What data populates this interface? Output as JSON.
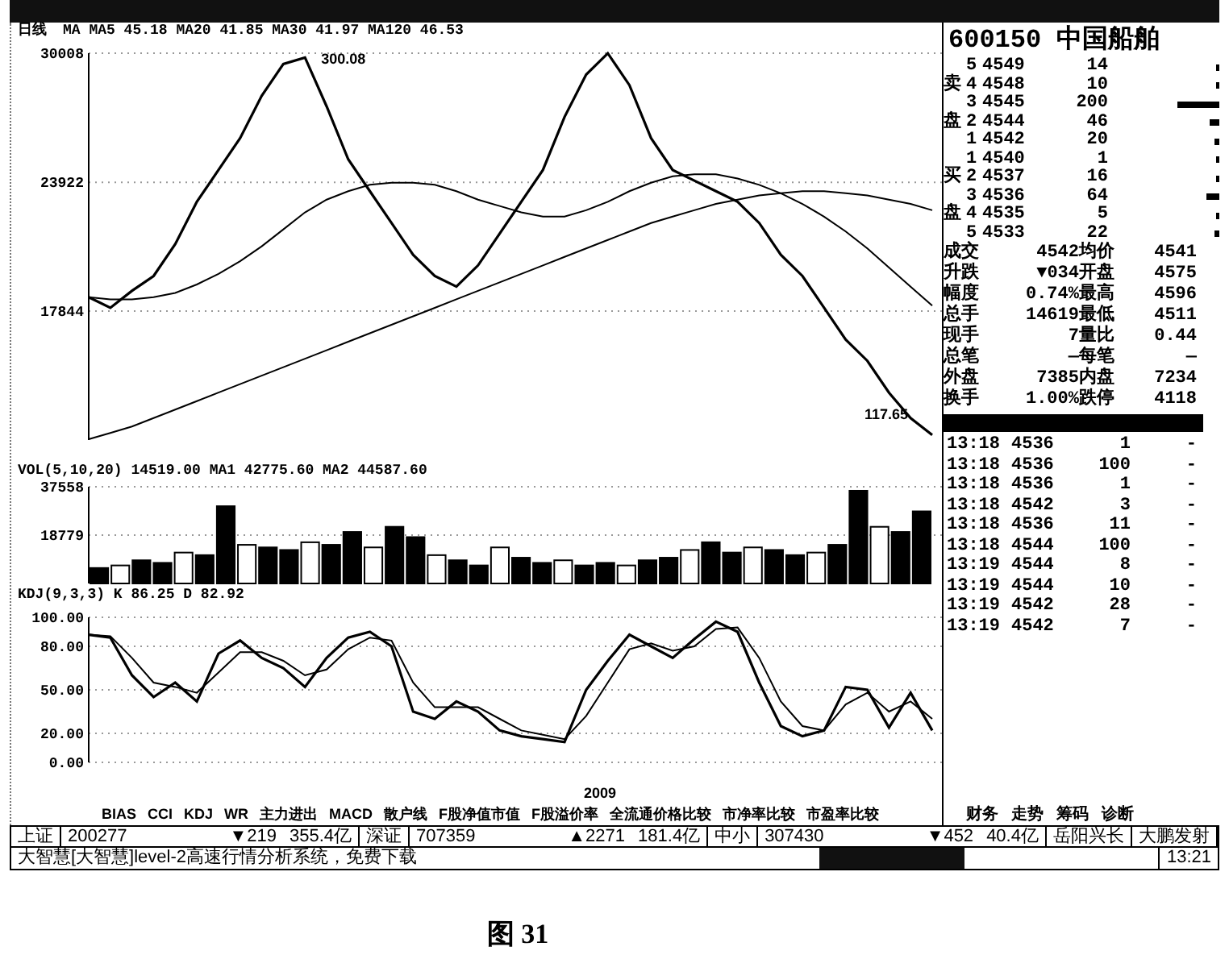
{
  "price_panel": {
    "period": "日线",
    "legend": "MA MA5 45.18 MA20 41.85 MA30 41.97 MA120 46.53",
    "chart_data": {
      "type": "line",
      "grid": true,
      "ylim": [
        11765,
        30008
      ],
      "yticks": [
        17844,
        23922,
        30008
      ],
      "series": [
        {
          "color": "#000000",
          "values": [
            18500,
            18000,
            18800,
            19500,
            21000,
            23000,
            24500,
            26000,
            28000,
            29500,
            29800,
            27500,
            25000,
            23500,
            22000,
            20500,
            19500,
            19000,
            20000,
            21500,
            23000,
            24500,
            27000,
            29000,
            30000,
            28500,
            26000,
            24500,
            24000,
            23500,
            23000,
            22000,
            20500,
            19500,
            18000,
            16500,
            15500,
            14000,
            12800,
            12000
          ]
        },
        {
          "color": "#000000",
          "values": [
            18500,
            18400,
            18400,
            18500,
            18700,
            19100,
            19600,
            20200,
            20900,
            21700,
            22500,
            23100,
            23500,
            23800,
            23900,
            23900,
            23800,
            23500,
            23100,
            22800,
            22500,
            22300,
            22300,
            22600,
            23000,
            23500,
            23900,
            24200,
            24300,
            24300,
            24100,
            23800,
            23400,
            22900,
            22300,
            21600,
            20800,
            19900,
            19000,
            18100
          ]
        },
        {
          "color": "#000000",
          "values": [
            11800,
            12100,
            12400,
            12800,
            13200,
            13600,
            14000,
            14400,
            14800,
            15200,
            15600,
            16000,
            16400,
            16800,
            17200,
            17600,
            18000,
            18400,
            18800,
            19200,
            19600,
            20000,
            20400,
            20800,
            21200,
            21600,
            22000,
            22300,
            22600,
            22900,
            23100,
            23300,
            23400,
            23500,
            23500,
            23400,
            23300,
            23100,
            22900,
            22600
          ]
        }
      ],
      "annotations": [
        "300.08",
        "117.65"
      ]
    }
  },
  "volume_panel": {
    "legend": "VOL(5,10,20) 14519.00 MA1 42775.60 MA2 44587.60",
    "chart_data": {
      "type": "bar",
      "grid": true,
      "ylim": [
        0,
        37558
      ],
      "yticks": [
        18779,
        37558
      ],
      "values": [
        6000,
        7000,
        9000,
        8000,
        12000,
        11000,
        30000,
        15000,
        14000,
        13000,
        16000,
        15000,
        20000,
        14000,
        22000,
        18000,
        11000,
        9000,
        7000,
        14000,
        10000,
        8000,
        9000,
        7000,
        8000,
        7000,
        9000,
        10000,
        13000,
        16000,
        12000,
        14000,
        13000,
        11000,
        12000,
        15000,
        36000,
        22000,
        20000,
        28000
      ]
    }
  },
  "kdj_panel": {
    "legend": "KDJ(9,3,3) K 86.25 D 82.92",
    "year_label": "2009",
    "chart_data": {
      "type": "line",
      "grid": true,
      "ylim": [
        0,
        100
      ],
      "yticks": [
        {
          "value": 0,
          "label": "0.00"
        },
        {
          "value": 20,
          "label": "20.00"
        },
        {
          "value": 50,
          "label": "50.00"
        },
        {
          "value": 80,
          "label": "80.00"
        },
        {
          "value": 100,
          "label": "100.00"
        }
      ],
      "series": [
        {
          "color": "#000000",
          "values": [
            88,
            86,
            60,
            45,
            55,
            42,
            75,
            84,
            72,
            65,
            52,
            72,
            86,
            90,
            80,
            35,
            30,
            42,
            35,
            22,
            18,
            16,
            14,
            50,
            70,
            88,
            80,
            72,
            85,
            97,
            90,
            55,
            25,
            18,
            22,
            52,
            50,
            24,
            48,
            22
          ]
        },
        {
          "color": "#000000",
          "values": [
            88,
            87,
            72,
            55,
            52,
            48,
            62,
            76,
            76,
            70,
            60,
            64,
            78,
            86,
            84,
            55,
            38,
            38,
            38,
            30,
            22,
            19,
            16,
            32,
            55,
            78,
            82,
            77,
            80,
            92,
            93,
            72,
            42,
            25,
            22,
            40,
            48,
            35,
            42,
            30
          ]
        }
      ]
    }
  },
  "indicator_tabs": [
    {
      "label": "BIAS",
      "selected": false
    },
    {
      "label": "CCI",
      "selected": false
    },
    {
      "label": "KDJ",
      "selected": false
    },
    {
      "label": "WR",
      "selected": false
    },
    {
      "label": "主力进出",
      "selected": false
    },
    {
      "label": "MACD",
      "selected": false
    },
    {
      "label": "散户线",
      "selected": false
    },
    {
      "label": "F股净值市值",
      "selected": false
    },
    {
      "label": "F股溢价率",
      "selected": false
    },
    {
      "label": "全流通价格比较",
      "selected": false
    },
    {
      "label": "市净率比较",
      "selected": false
    },
    {
      "label": "市盈率比较",
      "selected": false
    }
  ],
  "side_tabs": [
    {
      "label": "财务",
      "selected": false
    },
    {
      "label": "走势",
      "selected": false
    },
    {
      "label": "筹码",
      "selected": false
    },
    {
      "label": "诊断",
      "selected": false
    }
  ],
  "quote": {
    "title": "600150 中国船舶",
    "sell": [
      {
        "level_no": "5",
        "price": "4549",
        "volume": "14"
      },
      {
        "side_label": "卖",
        "level_no": "4",
        "price": "4548",
        "volume": "10"
      },
      {
        "level_no": "3",
        "price": "4545",
        "volume": "200"
      },
      {
        "side_label": "盘",
        "level_no": "2",
        "price": "4544",
        "volume": "46"
      },
      {
        "level_no": "1",
        "price": "4542",
        "volume": "20"
      }
    ],
    "buy": [
      {
        "level_no": "1",
        "price": "4540",
        "volume": "1"
      },
      {
        "side_label": "买",
        "level_no": "2",
        "price": "4537",
        "volume": "16"
      },
      {
        "level_no": "3",
        "price": "4536",
        "volume": "64"
      },
      {
        "side_label": "盘",
        "level_no": "4",
        "price": "4535",
        "volume": "5"
      },
      {
        "level_no": "5",
        "price": "4533",
        "volume": "22"
      }
    ],
    "stats": [
      {
        "label": "成交",
        "value": "4542",
        "label2": "均价",
        "value2": "4541"
      },
      {
        "label": "升跌",
        "value": "▼034",
        "label2": "开盘",
        "value2": "4575"
      },
      {
        "label": "幅度",
        "value": "0.74%",
        "label2": "最高",
        "value2": "4596"
      },
      {
        "label": "总手",
        "value": "14619",
        "label2": "最低",
        "value2": "4511"
      },
      {
        "label": "现手",
        "value": "7",
        "label2": "量比",
        "value2": "0.44"
      },
      {
        "label": "总笔",
        "value": "—",
        "label2": "每笔",
        "value2": "—"
      },
      {
        "label": "外盘",
        "value": "7385",
        "label2": "内盘",
        "value2": "7234"
      },
      {
        "label": "换手",
        "value": "1.00%",
        "label2": "跌停",
        "value2": "4118"
      }
    ],
    "ticks": [
      {
        "time": "13:18",
        "price": "4536",
        "volume": "1",
        "flag": "-"
      },
      {
        "time": "13:18",
        "price": "4536",
        "volume": "100",
        "flag": "-"
      },
      {
        "time": "13:18",
        "price": "4536",
        "volume": "1",
        "flag": "-"
      },
      {
        "time": "13:18",
        "price": "4542",
        "volume": "3",
        "flag": "-"
      },
      {
        "time": "13:18",
        "price": "4536",
        "volume": "11",
        "flag": "-"
      },
      {
        "time": "13:18",
        "price": "4544",
        "volume": "100",
        "flag": "-"
      },
      {
        "time": "13:19",
        "price": "4544",
        "volume": "8",
        "flag": "-"
      },
      {
        "time": "13:19",
        "price": "4544",
        "volume": "10",
        "flag": "-"
      },
      {
        "time": "13:19",
        "price": "4542",
        "volume": "28",
        "flag": "-"
      },
      {
        "time": "13:19",
        "price": "4542",
        "volume": "7",
        "flag": "-"
      }
    ]
  },
  "status_bar": {
    "indices": [
      {
        "name": "上证",
        "value": "200277",
        "change": "▼219",
        "amount": "355.4亿"
      },
      {
        "name": "深证",
        "value": "707359",
        "change": "▲2271",
        "amount": "181.4亿"
      },
      {
        "name": "中小",
        "value": "307430",
        "change": "▼452",
        "amount": "40.4亿"
      }
    ],
    "news": [
      "岳阳兴长",
      "大鹏发射"
    ],
    "message": "大智慧[大智慧]level-2高速行情分析系统，免费下载",
    "time": "13:21"
  },
  "caption": "图 31"
}
